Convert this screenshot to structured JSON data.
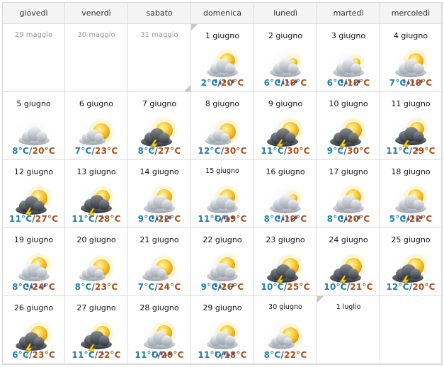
{
  "calendar": {
    "headers": [
      "giovedì",
      "venerdì",
      "sabato",
      "domenica",
      "lunedì",
      "martedì",
      "mercoledì"
    ],
    "weeks": [
      [
        {
          "date": "29 maggio",
          "past": true
        },
        {
          "date": "30 maggio",
          "past": true
        },
        {
          "date": "31 maggio",
          "past": true
        },
        {
          "date": "1 giugno",
          "icon": "sun-cloud-rain-icon",
          "tmin": "2°C",
          "tmax": "20°C",
          "corner": "tl"
        },
        {
          "date": "2 giugno",
          "icon": "cloud-rain-icon",
          "tmin": "6°C",
          "tmax": "19°C"
        },
        {
          "date": "3 giugno",
          "icon": "cloud-rain-icon",
          "tmin": "6°C",
          "tmax": "18°C"
        },
        {
          "date": "4 giugno",
          "icon": "sun-cloud-rain-icon",
          "tmin": "7°C",
          "tmax": "18°C"
        }
      ],
      [
        {
          "date": "5 giugno",
          "icon": "cloud-icon",
          "tmin": "8°C",
          "tmax": "20°C"
        },
        {
          "date": "6 giugno",
          "icon": "sun-cloud-icon",
          "tmin": "7°C",
          "tmax": "23°C"
        },
        {
          "date": "7 giugno",
          "icon": "sun-storm-icon",
          "tmin": "8°C",
          "tmax": "27°C"
        },
        {
          "date": "8 giugno",
          "icon": "sun-cloud-icon",
          "tmin": "12°C",
          "tmax": "30°C"
        },
        {
          "date": "9 giugno",
          "icon": "sun-storm-icon",
          "tmin": "11°C",
          "tmax": "30°C"
        },
        {
          "date": "10 giugno",
          "icon": "sun-storm-icon",
          "tmin": "9°C",
          "tmax": "30°C"
        },
        {
          "date": "11 giugno",
          "icon": "storm-icon",
          "tmin": "11°C",
          "tmax": "29°C"
        }
      ],
      [
        {
          "date": "12 giugno",
          "icon": "sun-storm-icon",
          "tmin": "11°C",
          "tmax": "27°C"
        },
        {
          "date": "13 giugno",
          "icon": "storm-icon",
          "tmin": "11°C",
          "tmax": "28°C"
        },
        {
          "date": "14 giugno",
          "icon": "sun-cloud-rain-icon",
          "tmin": "9°C",
          "tmax": "22°C"
        },
        {
          "date": "15 giugno",
          "icon": "sun-cloud-rain-icon",
          "tmin": "11°C",
          "tmax": "19°C",
          "small": true
        },
        {
          "date": "16 giugno",
          "icon": "cloud-rain-icon",
          "tmin": "8°C",
          "tmax": "19°C"
        },
        {
          "date": "17 giugno",
          "icon": "sun-cloud-rain-icon",
          "tmin": "8°C",
          "tmax": "20°C"
        },
        {
          "date": "18 giugno",
          "icon": "sun-cloud-rain-icon",
          "tmin": "5°C",
          "tmax": "22°C"
        }
      ],
      [
        {
          "date": "19 giugno",
          "icon": "sun-cloud-rain-icon",
          "tmin": "8°C",
          "tmax": "24°C"
        },
        {
          "date": "20 giugno",
          "icon": "sun-cloud-icon",
          "tmin": "8°C",
          "tmax": "23°C"
        },
        {
          "date": "21 giugno",
          "icon": "sun-cloud-icon",
          "tmin": "7°C",
          "tmax": "24°C"
        },
        {
          "date": "22 giugno",
          "icon": "sun-cloud-rain-icon",
          "tmin": "9°C",
          "tmax": "26°C"
        },
        {
          "date": "23 giugno",
          "icon": "sun-storm-icon",
          "tmin": "10°C",
          "tmax": "25°C"
        },
        {
          "date": "24 giugno",
          "icon": "sun-storm-icon",
          "tmin": "10°C",
          "tmax": "21°C"
        },
        {
          "date": "25 giugno",
          "icon": "sun-storm-icon",
          "tmin": "12°C",
          "tmax": "20°C"
        }
      ],
      [
        {
          "date": "26 giugno",
          "icon": "sun-storm-icon",
          "tmin": "6°C",
          "tmax": "23°C"
        },
        {
          "date": "27 giugno",
          "icon": "storm-icon",
          "tmin": "11°C",
          "tmax": "22°C"
        },
        {
          "date": "28 giugno",
          "icon": "sun-cloud-rain-icon",
          "tmin": "11°C",
          "tmax": "20°C"
        },
        {
          "date": "29 giugno",
          "icon": "sun-cloud-rain-icon",
          "tmin": "11°C",
          "tmax": "18°C"
        },
        {
          "date": "30 giugno",
          "icon": "sun-cloud-icon",
          "tmin": "8°C",
          "tmax": "22°C",
          "small": true
        },
        {
          "date": "1 luglio",
          "corner": "tl",
          "small": true
        },
        {
          "date": ""
        }
      ]
    ],
    "past_corner_cell": "31 maggio"
  },
  "colors": {
    "tmin": "#1f7fa6",
    "tmax": "#a9501c",
    "header_bg": "#f4f4f4",
    "grid": "#dcdcdc"
  }
}
